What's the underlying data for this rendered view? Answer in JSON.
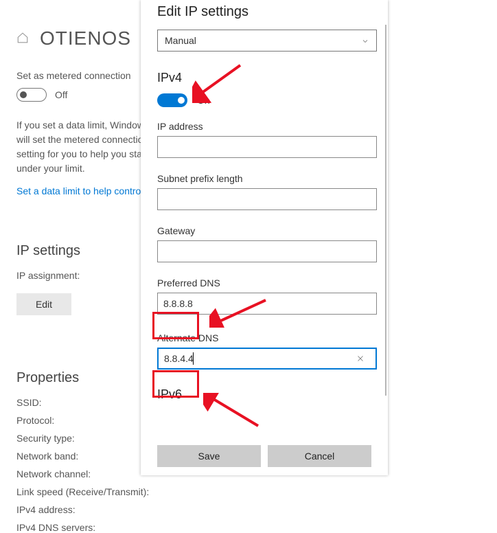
{
  "background": {
    "title": "OTIENOS",
    "metered_label": "Set as metered connection",
    "metered_toggle": "Off",
    "metered_para": "If you set a data limit, Windows will set the metered connection setting for you to help you stay under your limit.",
    "data_limit_link": "Set a data limit to help control data usage on this network",
    "ip_settings_heading": "IP settings",
    "ip_assignment_label": "IP assignment:",
    "edit_button": "Edit",
    "properties_heading": "Properties",
    "props": {
      "ssid": "SSID:",
      "protocol": "Protocol:",
      "security": "Security type:",
      "band": "Network band:",
      "channel": "Network channel:",
      "linkspeed": "Link speed (Receive/Transmit):",
      "ipv4addr": "IPv4 address:",
      "ipv4dns": "IPv4 DNS servers:"
    }
  },
  "dialog": {
    "title": "Edit IP settings",
    "mode_selected": "Manual",
    "ipv4": {
      "heading": "IPv4",
      "toggle_label": "On",
      "ip_label": "IP address",
      "ip_value": "",
      "subnet_label": "Subnet prefix length",
      "subnet_value": "",
      "gateway_label": "Gateway",
      "gateway_value": "",
      "pref_dns_label": "Preferred DNS",
      "pref_dns_value": "8.8.8.8",
      "alt_dns_label": "Alternate DNS",
      "alt_dns_value": "8.8.4.4"
    },
    "ipv6_heading": "IPv6",
    "save_label": "Save",
    "cancel_label": "Cancel"
  }
}
